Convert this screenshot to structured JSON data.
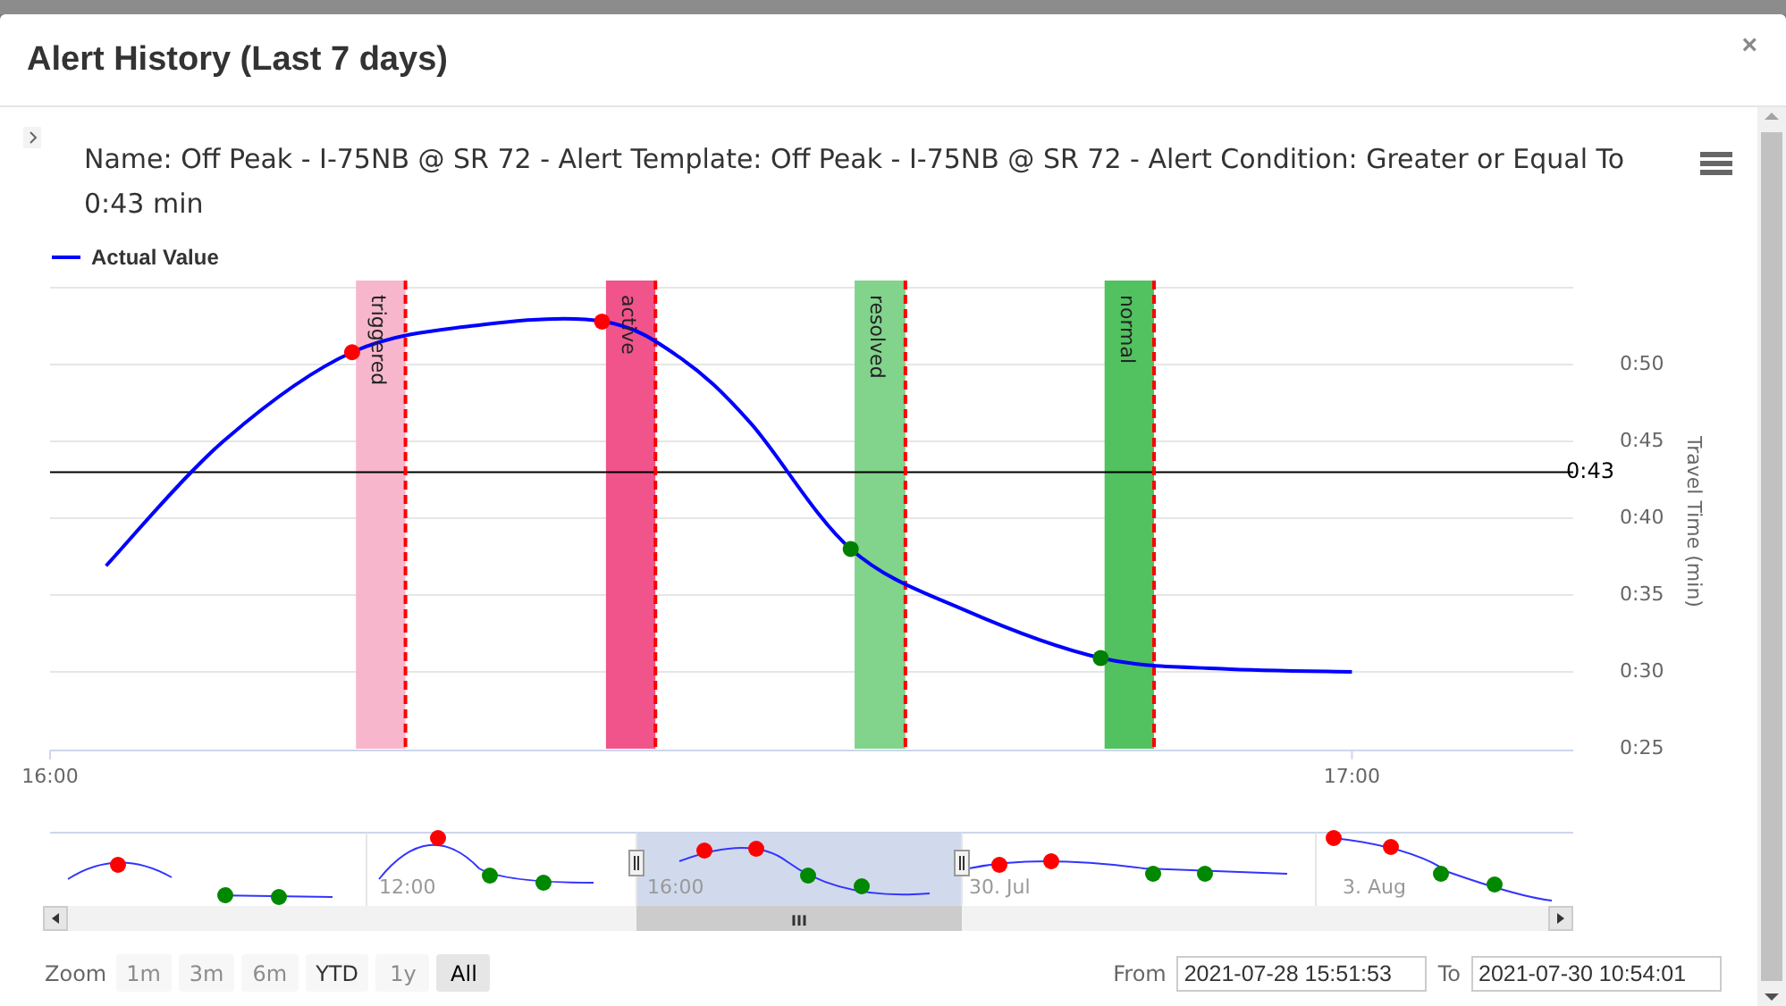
{
  "dialog": {
    "title": "Alert History (Last 7 days)",
    "close": "×"
  },
  "chart": {
    "title": "Name: Off Peak - I-75NB @ SR 72 - Alert Template: Off Peak - I-75NB @ SR 72 - Alert Condition: Greater or Equal To 0:43 min",
    "chart_data": {
      "type": "line",
      "ylabel": "Travel Time (min)",
      "grid": true,
      "x": [
        16.043,
        16.133,
        16.232,
        16.333,
        16.425,
        16.483,
        16.538,
        16.615,
        16.703,
        16.807,
        16.9,
        17.0
      ],
      "series": [
        {
          "name": "Actual Value",
          "color": "#0000ff",
          "values": [
            36.9,
            45,
            50.8,
            52.6,
            52.8,
            50.5,
            46.2,
            38.0,
            34.0,
            30.9,
            30.2,
            30.0
          ]
        }
      ],
      "xlim": [
        16,
        17.17
      ],
      "ylim": [
        25,
        55
      ],
      "xticks": [
        {
          "value": 16,
          "label": "16:00"
        },
        {
          "value": 17,
          "label": "17:00"
        }
      ],
      "yticks": [
        {
          "value": 25,
          "label": "0:25"
        },
        {
          "value": 30,
          "label": "0:30"
        },
        {
          "value": 35,
          "label": "0:35"
        },
        {
          "value": 40,
          "label": "0:40"
        },
        {
          "value": 45,
          "label": "0:45"
        },
        {
          "value": 50,
          "label": "0:50"
        }
      ],
      "bands": [
        {
          "axis": "x",
          "from": 16.235,
          "to": 16.273,
          "color": "#f7b6cc",
          "label": "triggered"
        },
        {
          "axis": "x",
          "from": 16.427,
          "to": 16.465,
          "color": "#f0548a",
          "label": "active"
        },
        {
          "axis": "x",
          "from": 16.618,
          "to": 16.657,
          "color": "#82d38c",
          "label": "resolved"
        },
        {
          "axis": "x",
          "from": 16.81,
          "to": 16.848,
          "color": "#52c160",
          "label": "normal"
        }
      ],
      "ref_lines": [
        {
          "axis": "y",
          "value": 43,
          "label": "0:43",
          "color": "#000000"
        },
        {
          "axis": "x",
          "value": 16.273,
          "color": "#ff0000"
        },
        {
          "axis": "x",
          "value": 16.465,
          "color": "#ff0000"
        },
        {
          "axis": "x",
          "value": 16.657,
          "color": "#ff0000"
        },
        {
          "axis": "x",
          "value": 16.848,
          "color": "#ff0000"
        }
      ]
    },
    "markers": [
      {
        "color": "#ff0000"
      },
      {
        "color": "#ff0000"
      },
      {
        "color": "#008000"
      },
      {
        "color": "#008000"
      }
    ]
  },
  "navigator": {
    "labels": [
      "12:00",
      "16:00",
      "30. Jul",
      "3. Aug"
    ],
    "scrollbar_grip": "III"
  },
  "zoom": {
    "label": "Zoom",
    "buttons": [
      {
        "label": "1m",
        "disabled": true,
        "selected": false
      },
      {
        "label": "3m",
        "disabled": true,
        "selected": false
      },
      {
        "label": "6m",
        "disabled": true,
        "selected": false
      },
      {
        "label": "YTD",
        "disabled": false,
        "selected": false
      },
      {
        "label": "1y",
        "disabled": true,
        "selected": false
      },
      {
        "label": "All",
        "disabled": false,
        "selected": true
      }
    ]
  },
  "range": {
    "from_label": "From",
    "from": "2021-07-28 15:51:53",
    "to_label": "To",
    "to": "2021-07-30 10:54:01"
  }
}
